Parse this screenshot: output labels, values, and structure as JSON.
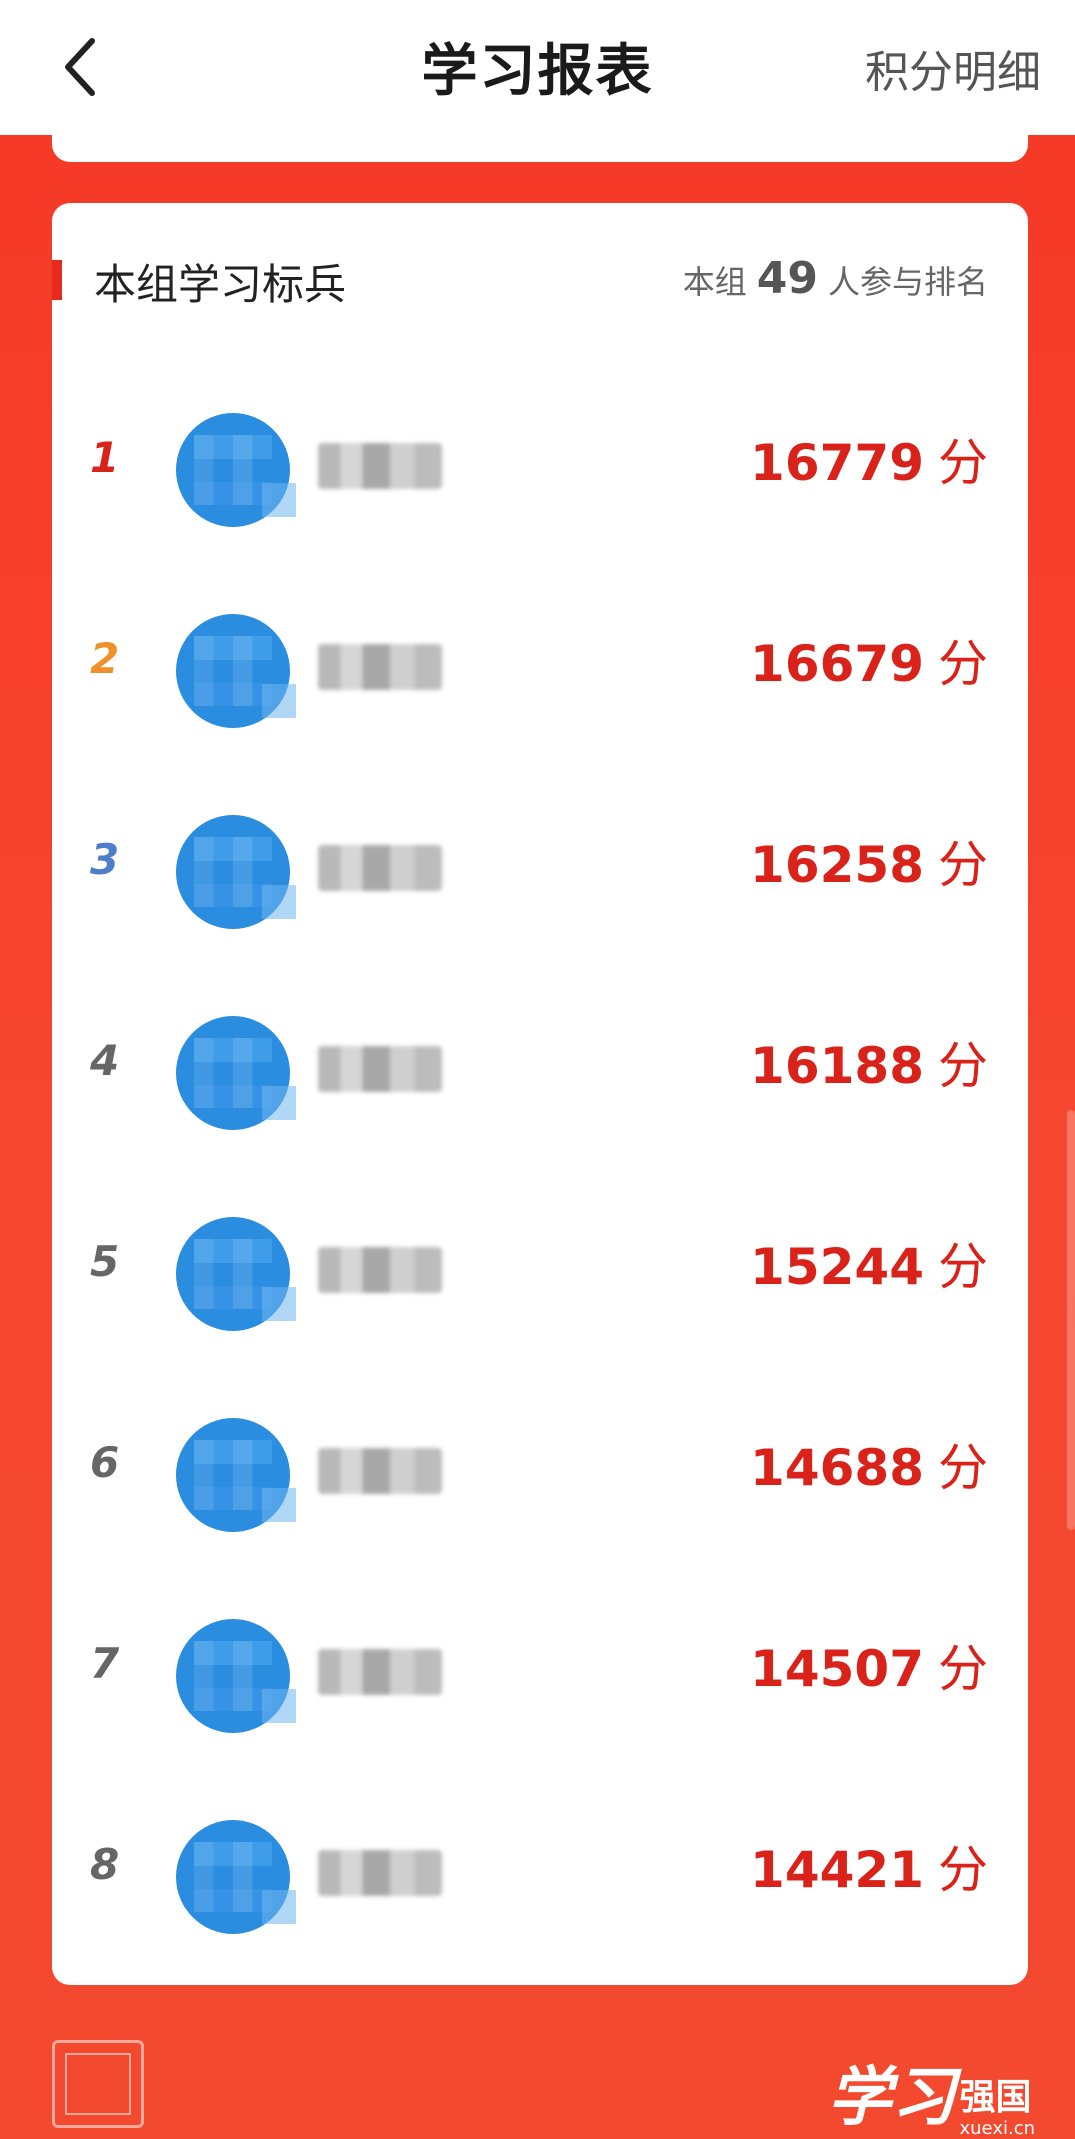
{
  "header": {
    "title": "学习报表",
    "right_link": "积分明细",
    "back_icon": "chevron-left-icon"
  },
  "card": {
    "title": "本组学习标兵",
    "participants_prefix": "本组",
    "participants_count": "49",
    "participants_suffix": "人参与排名"
  },
  "ranking": [
    {
      "rank": "1",
      "score": "16779",
      "unit": "分",
      "rank_color": "#d9231a"
    },
    {
      "rank": "2",
      "score": "16679",
      "unit": "分",
      "rank_color": "#f0902a"
    },
    {
      "rank": "3",
      "score": "16258",
      "unit": "分",
      "rank_color": "#4f7ec8"
    },
    {
      "rank": "4",
      "score": "16188",
      "unit": "分",
      "rank_color": "#666666"
    },
    {
      "rank": "5",
      "score": "15244",
      "unit": "分",
      "rank_color": "#666666"
    },
    {
      "rank": "6",
      "score": "14688",
      "unit": "分",
      "rank_color": "#666666"
    },
    {
      "rank": "7",
      "score": "14507",
      "unit": "分",
      "rank_color": "#666666"
    },
    {
      "rank": "8",
      "score": "14421",
      "unit": "分",
      "rank_color": "#666666"
    }
  ],
  "footer": {
    "logo_brush": "学习",
    "logo_text": "强国",
    "logo_url": "xuexi.cn"
  },
  "colors": {
    "accent": "#e62a1c",
    "score": "#d9231a",
    "background": "#f2492f"
  }
}
